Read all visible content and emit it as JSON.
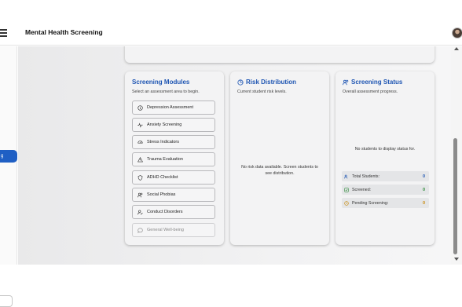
{
  "header": {
    "title": "Mental Health Screening"
  },
  "sidebar": {
    "active_label": "g"
  },
  "modules_card": {
    "title": "Screening Modules",
    "subtitle": "Select an assessment area to begin.",
    "items": [
      {
        "label": "Depression Assessment",
        "icon": "info-circle-icon"
      },
      {
        "label": "Anxiety Screening",
        "icon": "activity-pulse-icon"
      },
      {
        "label": "Stress Indicators",
        "icon": "gauge-icon"
      },
      {
        "label": "Trauma Evaluation",
        "icon": "warning-triangle-icon"
      },
      {
        "label": "ADHD Checklist",
        "icon": "shield-icon"
      },
      {
        "label": "Social Phobias",
        "icon": "users-icon"
      },
      {
        "label": "Conduct Disorders",
        "icon": "user-check-icon"
      },
      {
        "label": "General Well-being",
        "icon": "chat-bubble-icon"
      }
    ]
  },
  "risk_card": {
    "title": "Risk Distribution",
    "subtitle": "Current student risk levels.",
    "empty_line1": "No risk data available. Screen students to",
    "empty_line2": "see distribution."
  },
  "status_card": {
    "title": "Screening Status",
    "subtitle": "Overall assessment progress.",
    "empty": "No students to display status for.",
    "stats": [
      {
        "label": "Total Students:",
        "value": "0",
        "color": "#1f56b3"
      },
      {
        "label": "Screened:",
        "value": "0",
        "color": "#2e8b3a"
      },
      {
        "label": "Pending Screening:",
        "value": "0",
        "color": "#c98a0a"
      }
    ]
  },
  "colors": {
    "accent": "#1f56b3",
    "sidebar_active": "#1f5fc4"
  }
}
